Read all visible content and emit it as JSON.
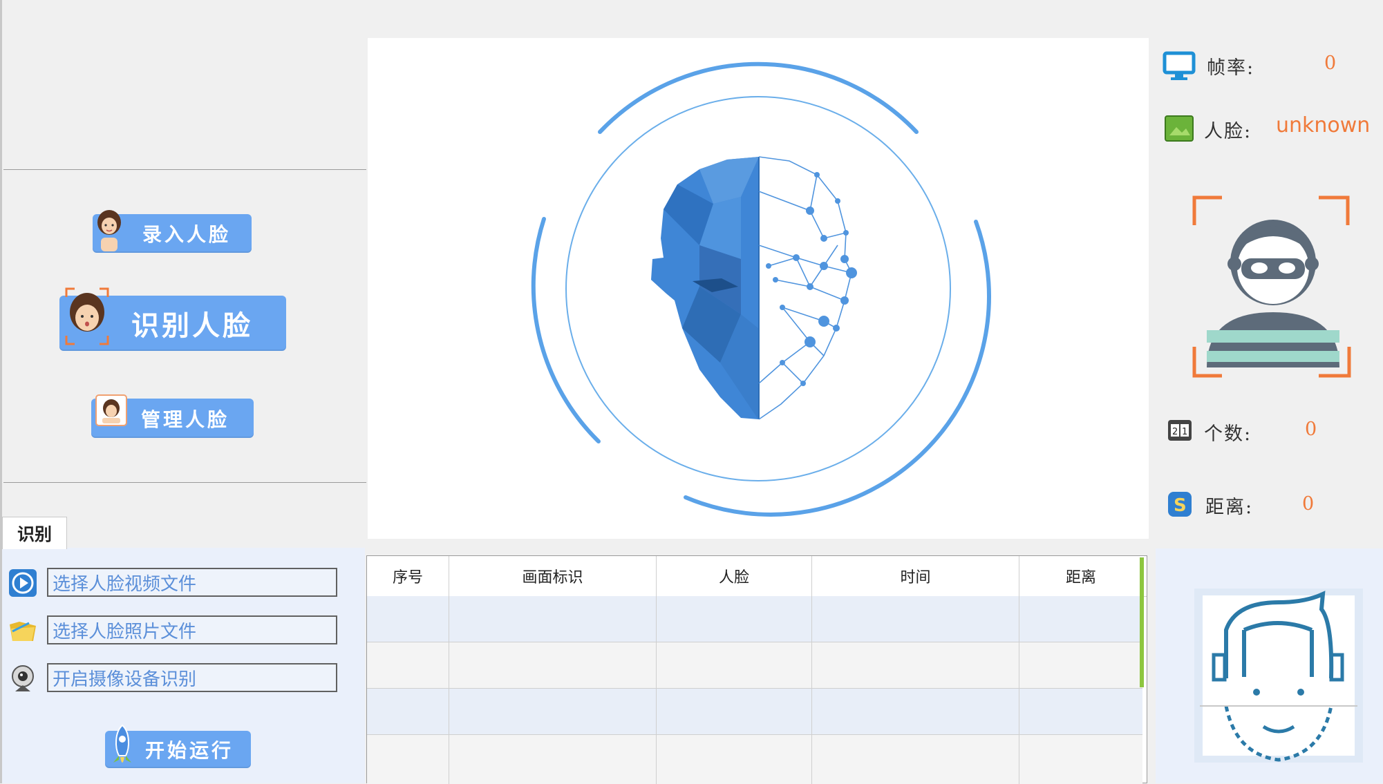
{
  "left_panel": {
    "btn_enroll": "录入人脸",
    "btn_recognize": "识别人脸",
    "btn_manage": "管理人脸"
  },
  "tab": {
    "label": "识别"
  },
  "sources": [
    {
      "label": "选择人脸视频文件",
      "icon": "video-play-icon"
    },
    {
      "label": "选择人脸照片文件",
      "icon": "folder-icon"
    },
    {
      "label": "开启摄像设备识别",
      "icon": "webcam-icon"
    }
  ],
  "start_button": "开始运行",
  "table": {
    "columns": [
      "序号",
      "画面标识",
      "人脸",
      "时间",
      "距离"
    ],
    "rows": [
      [
        "",
        "",
        "",
        "",
        ""
      ],
      [
        "",
        "",
        "",
        "",
        ""
      ],
      [
        "",
        "",
        "",
        "",
        ""
      ],
      [
        "",
        "",
        "",
        "",
        ""
      ]
    ]
  },
  "stats": {
    "fps_label": "帧率:",
    "fps_value": "0",
    "face_label": "人脸:",
    "face_value": "unknown",
    "count_label": "个数:",
    "count_value": "0",
    "distance_label": "距离:",
    "distance_value": "0"
  },
  "colors": {
    "accent": "#6aa6f1",
    "value": "#f07a3a",
    "face_blue": "#3f86d6"
  }
}
